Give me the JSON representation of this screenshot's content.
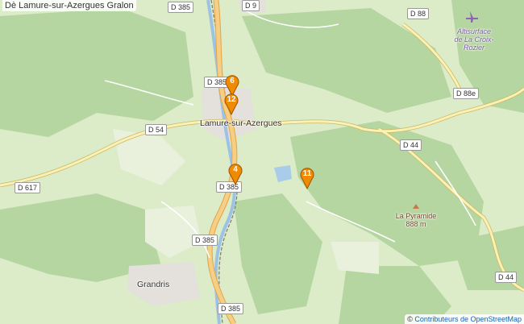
{
  "map": {
    "title": "Dè Lamure-sur-Azergues Gralon",
    "attribution": {
      "prefix": "© ",
      "link_text": "Contributeurs de OpenStreetMap"
    },
    "colors": {
      "forest": "#b4d4a0",
      "meadow": "#dcebc8",
      "road_primary": "#f6cf84",
      "road_secondary": "#fbf1b6",
      "river": "#9cc3e3",
      "marker": "#f08a00"
    },
    "road_labels": [
      "D 385",
      "D 9",
      "D 88",
      "D 385",
      "D 88e",
      "D 54",
      "D 44",
      "D 617",
      "D 385",
      "D 385",
      "D 44",
      "D 385"
    ],
    "places": {
      "town": "Lamure-sur-Azergues",
      "grandris": "Grandris",
      "peak_name": "La Pyramide",
      "peak_elevation": "888 m",
      "airfield_line1": "Altisurface",
      "airfield_line2": "de La Croix-",
      "airfield_line3": "Rozier"
    },
    "markers": [
      "6",
      "12",
      "4",
      "11"
    ]
  }
}
